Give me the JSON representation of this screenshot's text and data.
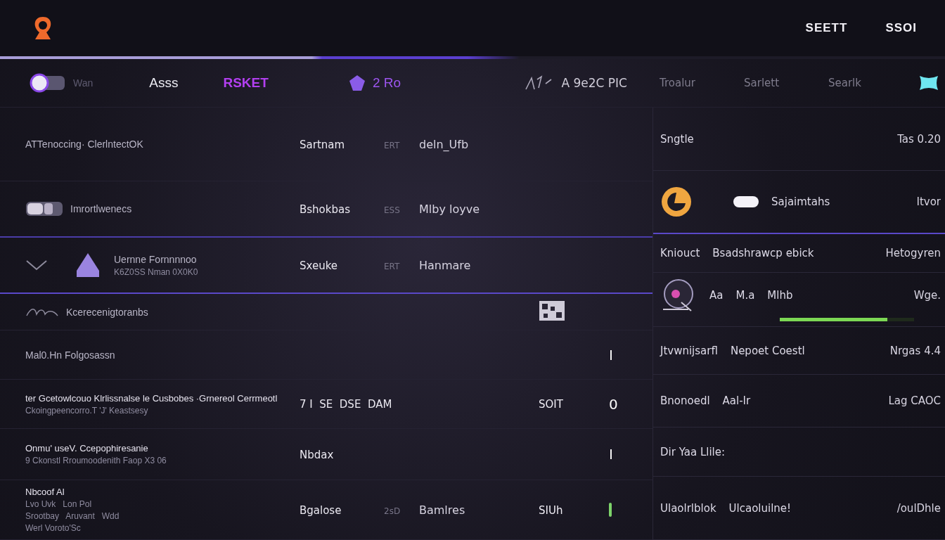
{
  "header": {
    "actions": [
      "SEETT",
      "SSOI"
    ],
    "progress": {
      "level": 0.55
    }
  },
  "tabs": [
    {
      "label": "Wan",
      "selected": false,
      "disabled": true
    },
    {
      "label": "Asss",
      "selected": false,
      "disabled": false
    },
    {
      "label": "RSKET",
      "selected": true,
      "disabled": false
    }
  ],
  "counter": "2 Ro",
  "tool_label": "A 9e2C PIC",
  "side_tabs": [
    "Troalur",
    "Sarlett",
    "Searlk"
  ],
  "rows": [
    {
      "column_1": [
        "ATTenoccing· ClerlntectOK"
      ],
      "column_2": "Sartnam",
      "column_3": "ERT",
      "column_4": "deln_Ufb"
    },
    {
      "column_1": [
        "Imrortlwenecs"
      ],
      "column_2": "Bshokbas",
      "column_3": "ESS",
      "column_4": "Mlby loyve"
    },
    {
      "column_1": [
        "Uernne Fornnnnoo",
        "K6Z0SS Nman 0X0K0"
      ],
      "column_2": "Sxeuke",
      "column_3": "ERT",
      "column_4": "Hanmare"
    },
    {
      "column_1": [
        "Kcerecenigtoranbs"
      ]
    },
    {
      "column_1": [
        "Mal0.Hn Folgosassn"
      ],
      "column_6": "I"
    },
    {
      "column_1": [
        "ter Gcetowlcouo Klrlissnalse le Cusbobes ·Grnereol Cerrmeotl",
        "Ckoingpeencorro.T 'J' Keastsesy"
      ],
      "column_2": "7 I  SE  DSE  DAM",
      "column_5": "SOIT",
      "column_6": "0"
    },
    {
      "column_1": [
        "Onmu' useV. Ccepophiresanie",
        "9 Ckonstl Rroumoodenith Faop X3 06"
      ],
      "column_2": "Nbdax",
      "column_6": "I"
    },
    {
      "column_1": [
        "Nbcoof Al",
        "Lvo Uvk   Lon Pol",
        "Srootbay   Aruvant   Wdd",
        "Werl Voroto'Sc"
      ],
      "column_2": "Bgalose",
      "column_3": "2sD",
      "column_4": "Bamlres",
      "column_5": "SIUh"
    }
  ],
  "side_rows": [
    {
      "column_1": [
        "Sngtle"
      ],
      "column_2": "Tas 0.20"
    },
    {
      "column_1": [
        "Sajaimtahs"
      ],
      "column_2": "Itvor"
    },
    {
      "column_1": [
        "Kniouct",
        "Bsadshrawcp ebick"
      ],
      "column_2": "Hetogyren"
    },
    {
      "column_1": [
        "Aa",
        "M.a",
        "Mlhb"
      ],
      "column_2": "Wge.",
      "level": 0.8
    },
    {
      "column_1": [
        "Jtvwnijsarfl",
        "Nepoet Coestl"
      ],
      "column_2": "Nrgas 4.4"
    },
    {
      "column_1": [
        "Bnonoedl",
        "Aal-Ir"
      ],
      "column_2": "Lag CAOC"
    },
    {
      "column_1": [
        "Dir Yaa Llile:"
      ]
    },
    {
      "column_1": [
        "Ulaolrlblok",
        "Ulcaoluilne!"
      ],
      "column_2": "/oulDhle"
    }
  ]
}
